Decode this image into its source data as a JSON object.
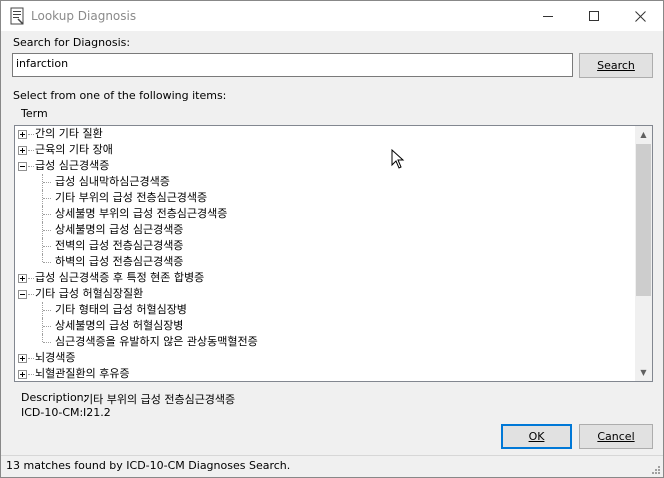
{
  "window": {
    "title": "Lookup Diagnosis"
  },
  "search": {
    "label": "Search for Diagnosis:",
    "value": "infarction",
    "button": "Search"
  },
  "list": {
    "label": "Select from one of the following items:",
    "column_header": "Term"
  },
  "tree": [
    {
      "level": 0,
      "expander": "plus",
      "text": "간의 기타 질환"
    },
    {
      "level": 0,
      "expander": "plus",
      "text": "근육의 기타 장애"
    },
    {
      "level": 0,
      "expander": "minus",
      "text": "급성 심근경색증"
    },
    {
      "level": 1,
      "text": "급성 심내막하심근경색증"
    },
    {
      "level": 1,
      "text": "기타 부위의 급성 전층심근경색증"
    },
    {
      "level": 1,
      "text": "상세불명 부위의 급성 전층심근경색증"
    },
    {
      "level": 1,
      "text": "상세불명의 급성 심근경색증"
    },
    {
      "level": 1,
      "text": "전벽의 급성 전층심근경색증"
    },
    {
      "level": 1,
      "text": "하벽의 급성 전층심근경색증"
    },
    {
      "level": 0,
      "expander": "plus",
      "text": "급성 심근경색증 후 특정 현존 합병증"
    },
    {
      "level": 0,
      "expander": "minus",
      "text": "기타 급성 허혈심장질환"
    },
    {
      "level": 1,
      "text": "기타 형태의 급성 허혈심장병"
    },
    {
      "level": 1,
      "text": "상세불명의 급성 허혈심장병"
    },
    {
      "level": 1,
      "text": "심근경색증을 유발하지 않은 관상동맥혈전증"
    },
    {
      "level": 0,
      "expander": "plus",
      "text": "뇌경색증"
    },
    {
      "level": 0,
      "expander": "plus",
      "text": "뇌혈관질환의 후유증"
    }
  ],
  "details": {
    "description_label": "Description:",
    "description_value": "기타 부위의 급성 전층심근경색증",
    "code_label": "ICD-10-CM:",
    "code_value": "I21.2"
  },
  "buttons": {
    "ok": "OK",
    "cancel": "Cancel"
  },
  "status": {
    "text": "13 matches found by ICD-10-CM Diagnoses Search."
  }
}
